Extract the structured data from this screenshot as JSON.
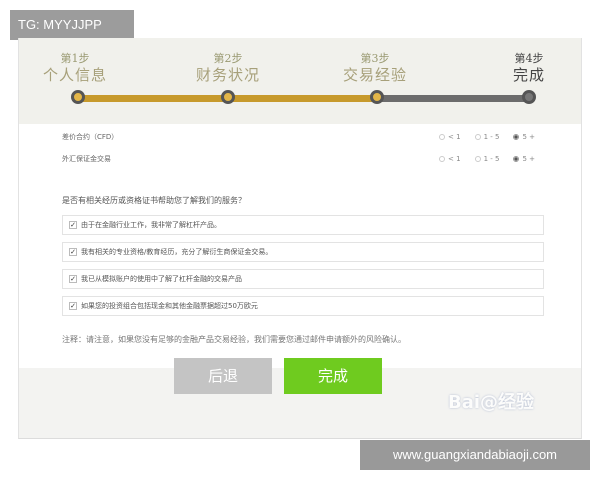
{
  "watermark_tag": "TG: MYYJJPP",
  "steps": [
    {
      "num": "第1步",
      "name": "个人信息",
      "state": "done"
    },
    {
      "num": "第2步",
      "name": "财务状况",
      "state": "done"
    },
    {
      "num": "第3步",
      "name": "交易经验",
      "state": "done"
    },
    {
      "num": "第4步",
      "name": "完成",
      "state": "current"
    }
  ],
  "experience_rows": [
    {
      "label": "差价合约（CFD）",
      "options": [
        "< 1",
        "1 - 5",
        "5 +"
      ],
      "selected": "5 +"
    },
    {
      "label": "外汇保证金交易",
      "options": [
        "< 1",
        "1 - 5",
        "5 +"
      ],
      "selected": "5 +"
    }
  ],
  "question": "是否有相关经历或资格证书帮助您了解我们的服务？",
  "checkboxes": [
    {
      "label": "由于在金融行业工作，我非常了解杠杆产品。",
      "checked": true
    },
    {
      "label": "我有相关的专业资格/教育经历，充分了解衍生商保证金交易。",
      "checked": true
    },
    {
      "label": "我已从模拟账户的使用中了解了杠杆金融的交易产品",
      "checked": true
    },
    {
      "label": "如果您的投资组合包括现金和其他金融票据超过50万欧元",
      "checked": true
    }
  ],
  "check_mark": "✓",
  "note": "注释：请注意，如果您没有足够的金融产品交易经验，我们需要您通过邮件申请额外的风险确认。",
  "buttons": {
    "back": "后退",
    "finish": "完成"
  },
  "baidu_watermark": "Bai@经验",
  "url_watermark": "www.guangxiandabiaoji.com",
  "colors": {
    "progress_done": "#c79a2c",
    "finish_button": "#6fcb1f",
    "back_button": "#c4c4c4"
  }
}
